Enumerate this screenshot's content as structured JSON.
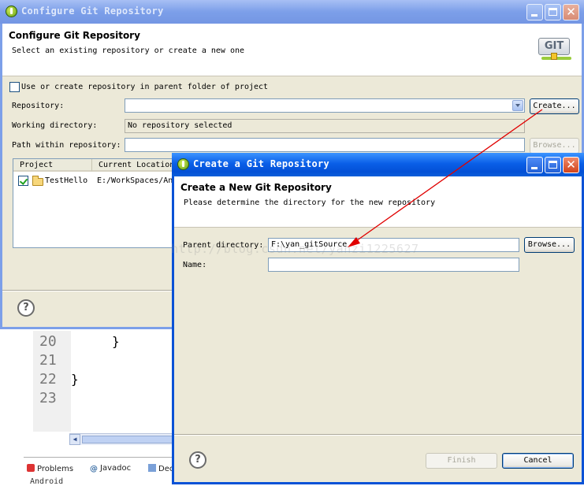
{
  "editor": {
    "line_numbers": [
      "20",
      "21",
      "22",
      "23"
    ],
    "code_lines": [
      "}",
      "",
      "}",
      ""
    ],
    "bottom_tabs": [
      "Problems",
      "Javadoc",
      "Dec"
    ],
    "tail_text": "Android"
  },
  "configure_dialog": {
    "title": "Configure Git Repository",
    "header_title": "Configure Git Repository",
    "header_desc": "Select an existing repository or create a new one",
    "logo_text": "GIT",
    "parent_folder_checkbox": {
      "label": "Use or create repository in parent folder of project",
      "checked": false
    },
    "repository_label": "Repository:",
    "repository_value": "",
    "create_button": "Create...",
    "working_dir_label": "Working directory:",
    "working_dir_value": "No repository selected",
    "path_label": "Path within repository:",
    "path_value": "",
    "browse_button": "Browse...",
    "table": {
      "columns": [
        "Project",
        "Current Location"
      ],
      "rows": [
        {
          "project": "TestHello",
          "location": "E:/WorkSpaces/An",
          "checked": true
        }
      ]
    }
  },
  "create_dialog": {
    "title": "Create a Git Repository",
    "header_title": "Create a New Git Repository",
    "header_desc": "Please determine the directory for the new repository",
    "parent_dir_label": "Parent directory:",
    "parent_dir_value": "F:\\yan_gitSource",
    "browse_button": "Browse...",
    "name_label": "Name:",
    "name_value": "",
    "finish_button": "Finish",
    "cancel_button": "Cancel"
  },
  "watermark": "http://blog.csdn.net/yanzi1225627",
  "colors": {
    "xp_title_active": "#0350d6",
    "xp_title_inactive": "#7c9fe9",
    "dialog_bg": "#ece9d8",
    "annotation_arrow": "#e00000"
  }
}
